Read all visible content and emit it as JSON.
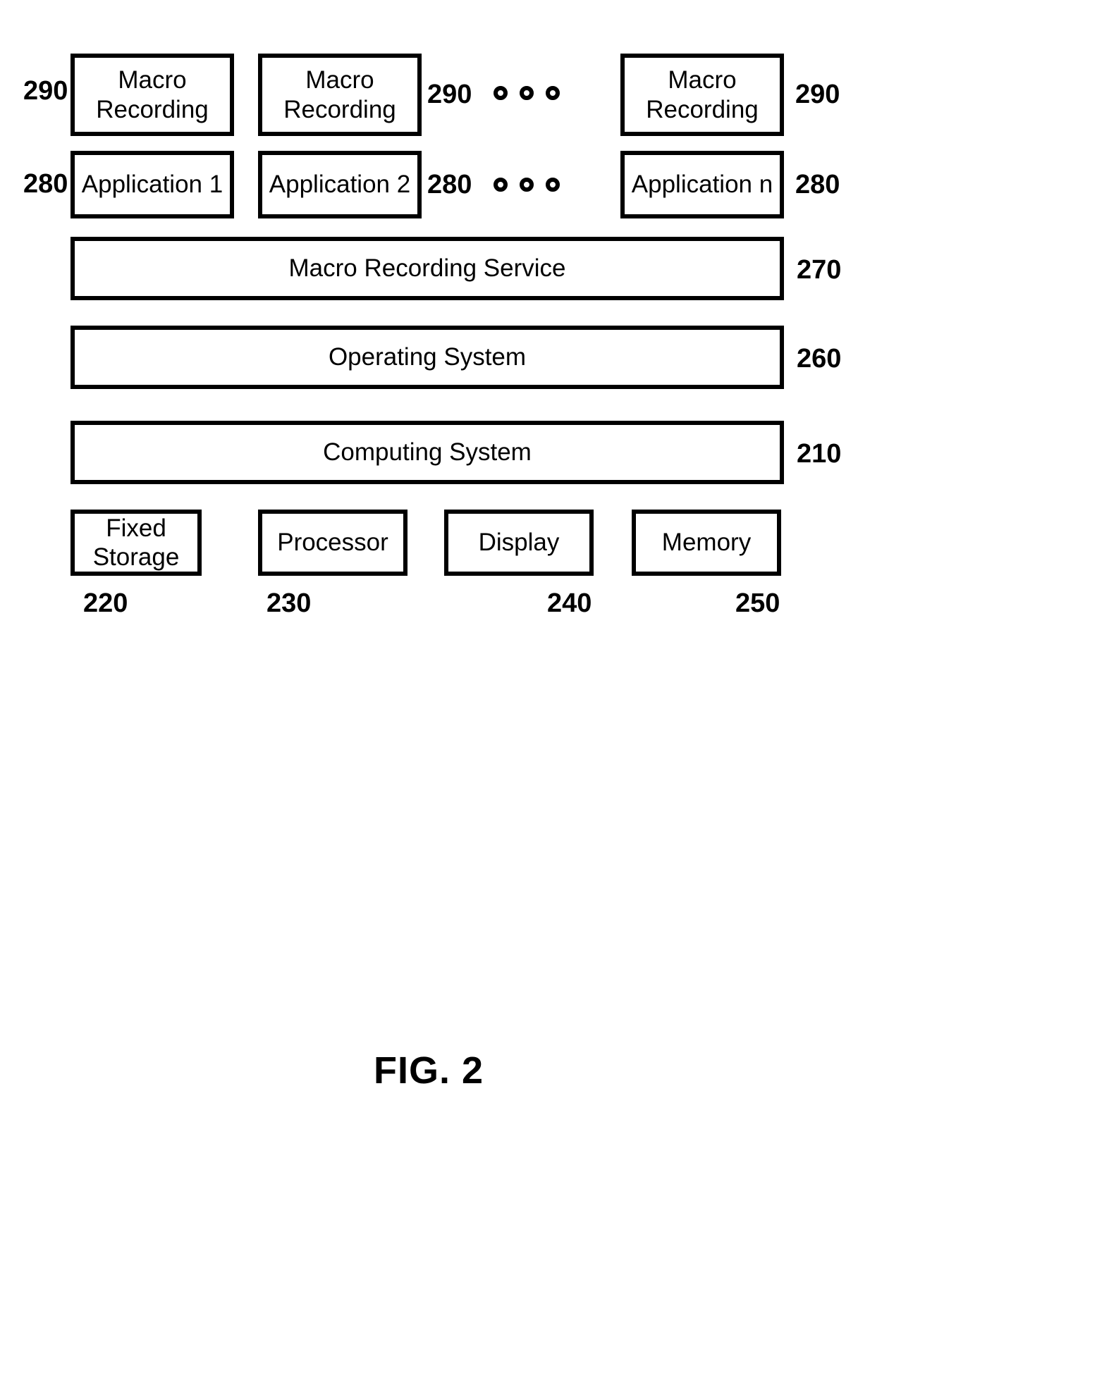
{
  "figure": {
    "caption": "FIG. 2",
    "type": "patent-block-diagram"
  },
  "layers": {
    "macro_recording_row": {
      "boxes": [
        {
          "label": "Macro\nRecording",
          "ref": "290",
          "ref_side": "left"
        },
        {
          "label": "Macro\nRecording",
          "ref": "290",
          "ref_side": "right"
        },
        {
          "label": "Macro\nRecording",
          "ref": "290",
          "ref_side": "right"
        }
      ],
      "ellipsis": "ooo"
    },
    "application_row": {
      "boxes": [
        {
          "label": "Application 1",
          "ref": "280",
          "ref_side": "left"
        },
        {
          "label": "Application 2",
          "ref": "280",
          "ref_side": "right"
        },
        {
          "label": "Application n",
          "ref": "280",
          "ref_side": "right"
        }
      ],
      "ellipsis": "ooo"
    },
    "bars": [
      {
        "label": "Macro Recording Service",
        "ref": "270"
      },
      {
        "label": "Operating System",
        "ref": "260"
      },
      {
        "label": "Computing System",
        "ref": "210"
      }
    ],
    "components": [
      {
        "label": "Fixed\nStorage",
        "ref": "220"
      },
      {
        "label": "Processor",
        "ref": "230"
      },
      {
        "label": "Display",
        "ref": "240"
      },
      {
        "label": "Memory",
        "ref": "250"
      }
    ]
  },
  "colors": {
    "stroke": "#000000",
    "fill": "#ffffff",
    "text": "#000000"
  }
}
